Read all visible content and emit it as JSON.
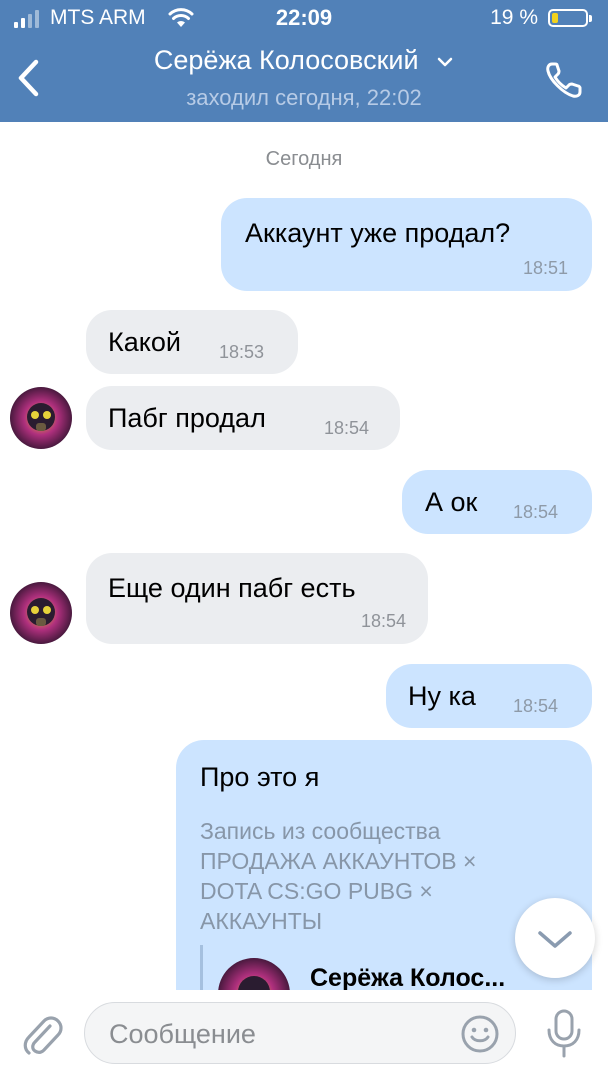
{
  "status_bar": {
    "carrier": "MTS ARM",
    "time": "22:09",
    "battery_text": "19 %",
    "battery_level": 0.19,
    "signal_bars": 2
  },
  "header": {
    "name": "Серёжа Колосовский",
    "last_seen": "заходил сегодня, 22:02",
    "back_icon": "chevron-left-icon",
    "call_icon": "phone-icon"
  },
  "chat": {
    "date_divider": "Сегодня",
    "messages": [
      {
        "text": "Аккаунт уже продал?",
        "time": "18:51",
        "direction": "out"
      },
      {
        "text": "Какой",
        "time": "18:53",
        "direction": "in"
      },
      {
        "text": "Пабг продал",
        "time": "18:54",
        "direction": "in"
      },
      {
        "text": "А ок",
        "time": "18:54",
        "direction": "out"
      },
      {
        "text": "Еще один пабг есть",
        "time": "18:54",
        "direction": "in"
      },
      {
        "text": "Ну ка",
        "time": "18:54",
        "direction": "out"
      },
      {
        "text": "Про это я",
        "direction": "out",
        "attachment": {
          "community_label": "Запись из сообщества ПРОДАЖА АККАУНТОВ × DOTA CS:GO PUBG × АККАУНТЫ",
          "author": "Серёжа Колос..."
        }
      }
    ]
  },
  "input": {
    "placeholder": "Сообщение",
    "attach_icon": "paperclip-icon",
    "emoji_icon": "smile-icon",
    "mic_icon": "microphone-icon"
  },
  "colors": {
    "header_bg": "#5181b8",
    "outgoing_bubble": "#cce4ff",
    "incoming_bubble": "#ebedf0",
    "battery_low": "#f2d21e"
  }
}
